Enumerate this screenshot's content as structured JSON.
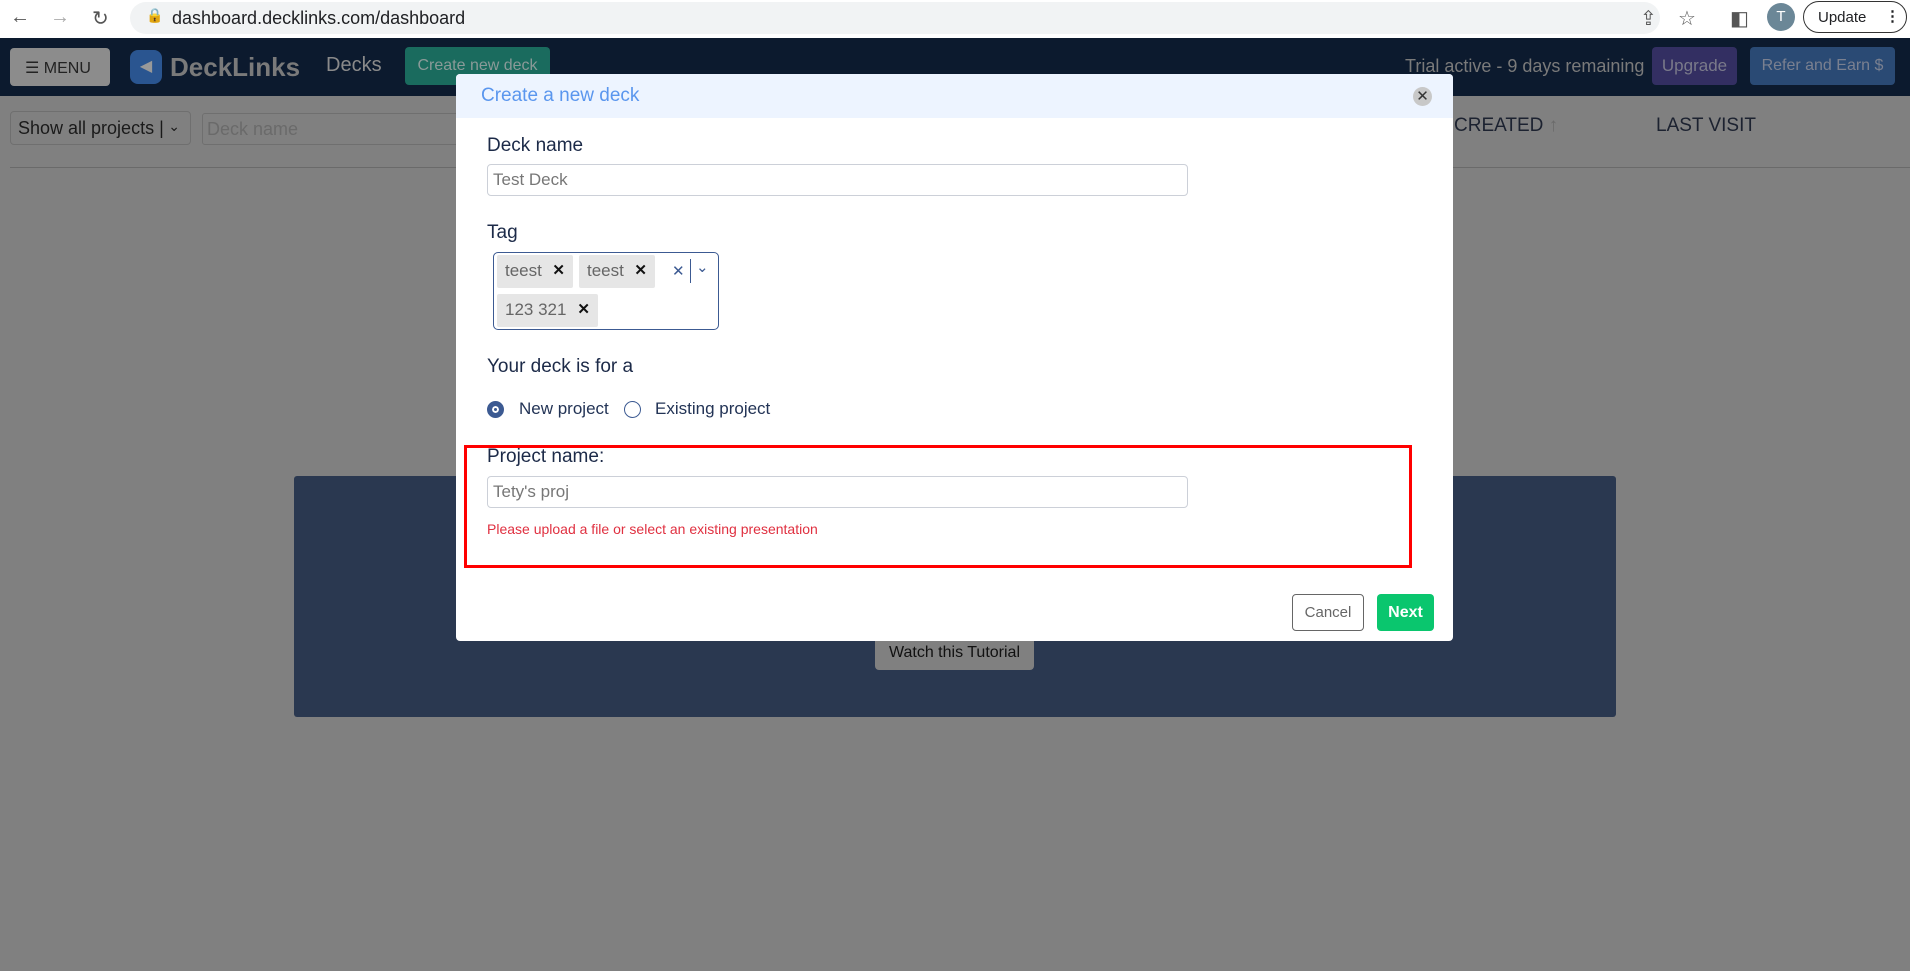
{
  "browser": {
    "url": "dashboard.decklinks.com/dashboard",
    "profile_initial": "T",
    "update_label": "Update"
  },
  "nav": {
    "menu_label": "MENU",
    "brand": "DeckLinks",
    "decks_label": "Decks",
    "create_label": "Create new deck",
    "trial_text": "Trial active - 9 days remaining",
    "upgrade_label": "Upgrade",
    "refer_label": "Refer and Earn $"
  },
  "filters": {
    "project_select": "Show all projects |",
    "deck_name_placeholder": "Deck name"
  },
  "table": {
    "columns": [
      "CREATED",
      "LAST VISIT"
    ]
  },
  "tutorial": {
    "label": "Watch this Tutorial"
  },
  "modal": {
    "title": "Create a new deck",
    "deck_name_label": "Deck name",
    "deck_name_value": "Test Deck",
    "tag_label": "Tag",
    "tags": [
      "teest",
      "teest",
      "123 321"
    ],
    "deck_for_label": "Your deck is for a",
    "options": [
      {
        "label": "New project",
        "selected": true
      },
      {
        "label": "Existing project",
        "selected": false
      }
    ],
    "project_name_label": "Project name:",
    "project_name_value": "Tety's proj",
    "error": "Please upload a file or select an existing presentation",
    "cancel_label": "Cancel",
    "next_label": "Next"
  },
  "colors": {
    "nav": "#0c1a2e",
    "accent": "#5a96ee",
    "next": "#0ac66e",
    "error": "#e03040",
    "highlight": "#ff0000"
  }
}
